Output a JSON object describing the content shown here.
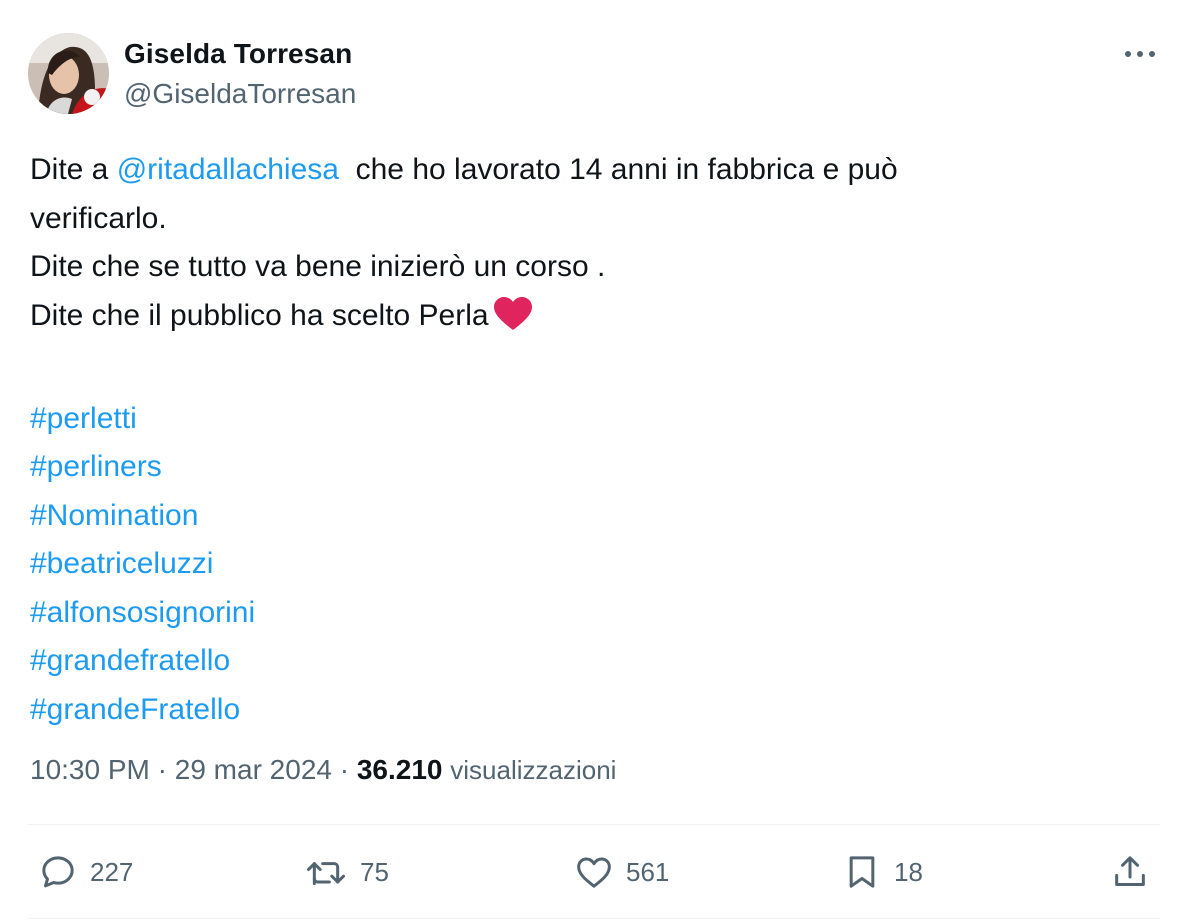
{
  "tweet": {
    "author": {
      "display_name": "Giselda Torresan",
      "handle": "@GiseldaTorresan"
    },
    "text": {
      "line1_prefix": "Dite a ",
      "mention": "@ritadallachiesa",
      "line1_suffix": "  che ho lavorato 14 anni in fabbrica e può",
      "line2": "verificarlo.",
      "line3": "Dite che se tutto va bene inizierò un corso .",
      "line4": "Dite che il pubblico ha scelto Perla"
    },
    "hashtags": [
      "#perletti",
      "#perliners",
      "#Nomination",
      "#beatriceluzzi",
      "#alfonsosignorini",
      "#grandefratello",
      "#grandeFratello"
    ],
    "meta": {
      "time": "10:30 PM",
      "separator": " · ",
      "date": "29 mar 2024",
      "views_count": "36.210",
      "views_label": "visualizzazioni"
    },
    "actions": {
      "replies": "227",
      "retweets": "75",
      "likes": "561",
      "bookmarks": "18"
    },
    "icons": {
      "more": "more-horizontal-icon",
      "reply": "reply-icon",
      "retweet": "retweet-icon",
      "like": "heart-outline-icon",
      "bookmark": "bookmark-icon",
      "share": "share-icon",
      "emoji": "red-heart-emoji"
    },
    "colors": {
      "link": "#1d9bf0",
      "text": "#0f1419",
      "secondary": "#536471",
      "heart_emoji": "#e0245e"
    }
  }
}
